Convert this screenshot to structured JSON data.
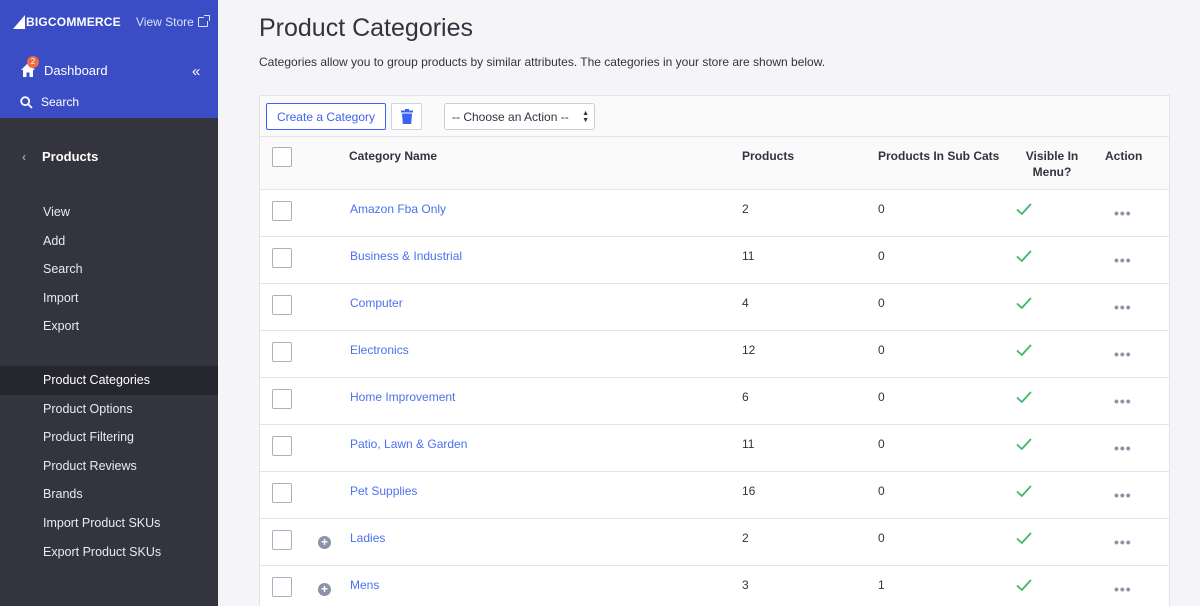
{
  "sidebar": {
    "logo_text": "BIGCOMMERCE",
    "view_store": "View Store",
    "dashboard": "Dashboard",
    "dashboard_badge": "2",
    "search": "Search",
    "products_section": "Products",
    "sub_items": [
      {
        "label": "View"
      },
      {
        "label": "Add"
      },
      {
        "label": "Search"
      },
      {
        "label": "Import"
      },
      {
        "label": "Export"
      }
    ],
    "sec_items": [
      {
        "label": "Product Categories",
        "active": true
      },
      {
        "label": "Product Options"
      },
      {
        "label": "Product Filtering"
      },
      {
        "label": "Product Reviews"
      },
      {
        "label": "Brands"
      },
      {
        "label": "Import Product SKUs"
      },
      {
        "label": "Export Product SKUs"
      }
    ]
  },
  "main": {
    "title": "Product Categories",
    "description": "Categories allow you to group products by similar attributes. The categories in your store are shown below.",
    "toolbar": {
      "create_label": "Create a Category",
      "action_select": "-- Choose an Action --"
    },
    "table": {
      "headers": {
        "name": "Category Name",
        "products": "Products",
        "sub_cats": "Products In Sub Cats",
        "visible": "Visible In Menu?",
        "action": "Action"
      },
      "rows": [
        {
          "name": "Amazon Fba Only",
          "products": "2",
          "sub": "0",
          "expandable": false
        },
        {
          "name": "Business & Industrial",
          "products": "11",
          "sub": "0",
          "expandable": false
        },
        {
          "name": "Computer",
          "products": "4",
          "sub": "0",
          "expandable": false
        },
        {
          "name": "Electronics",
          "products": "12",
          "sub": "0",
          "expandable": false
        },
        {
          "name": "Home Improvement",
          "products": "6",
          "sub": "0",
          "expandable": false
        },
        {
          "name": "Patio, Lawn & Garden",
          "products": "11",
          "sub": "0",
          "expandable": false
        },
        {
          "name": "Pet Supplies",
          "products": "16",
          "sub": "0",
          "expandable": false
        },
        {
          "name": "Ladies",
          "products": "2",
          "sub": "0",
          "expandable": true
        },
        {
          "name": "Mens",
          "products": "3",
          "sub": "1",
          "expandable": true
        }
      ]
    }
  },
  "colors": {
    "sidebar": "#34343f",
    "sidebar_top": "#3a4dc4",
    "link": "#4b71ec",
    "check": "#3fb86c"
  }
}
